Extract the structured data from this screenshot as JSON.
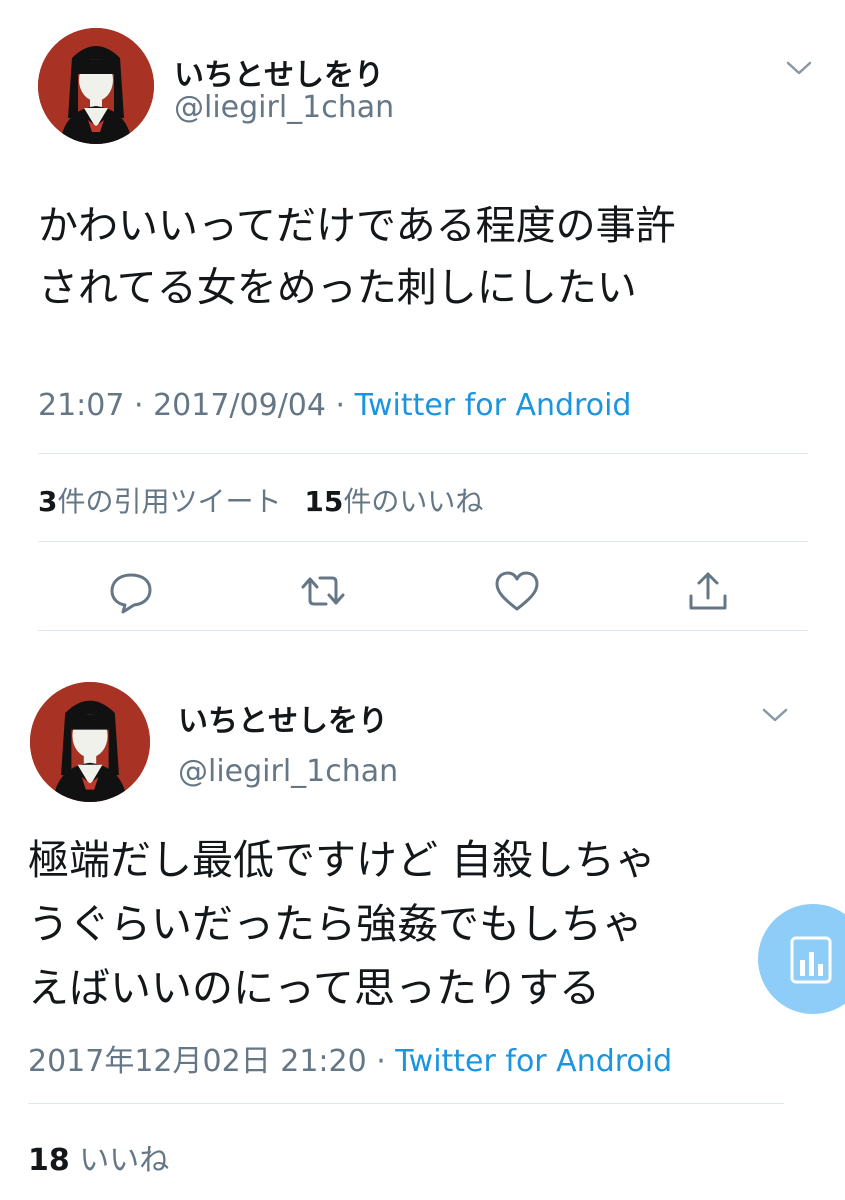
{
  "tweet1": {
    "display_name": "いちとせしをり",
    "handle": "@liegirl_1chan",
    "text_lines": [
      "かわいいってだけである程度の事許",
      "されてる女をめった刺しにしたい"
    ],
    "time": "21:07 · 2017/09/04 · ",
    "source": "Twitter for Android",
    "quote_count": "3",
    "quote_label": "件の引用ツイート",
    "like_count": "15",
    "like_label": "件のいいね",
    "actions": [
      "reply-icon",
      "retweet-icon",
      "like-icon",
      "share-icon"
    ]
  },
  "tweet2": {
    "display_name": "いちとせしをり",
    "handle": "@liegirl_1chan",
    "text_lines": [
      "極端だし最低ですけど 自殺しちゃ",
      "うぐらいだったら強姦でもしちゃ",
      "えばいいのにって思ったりする"
    ],
    "time": "2017年12月02日 21:20 · ",
    "source": "Twitter for Android",
    "like_count": "18",
    "like_label": " いいね"
  },
  "colors": {
    "text": "#14171a",
    "secondary": "#657786",
    "link": "#1b95e0",
    "avatar_bg": "#a83224",
    "fab": "#8ecdf8"
  }
}
